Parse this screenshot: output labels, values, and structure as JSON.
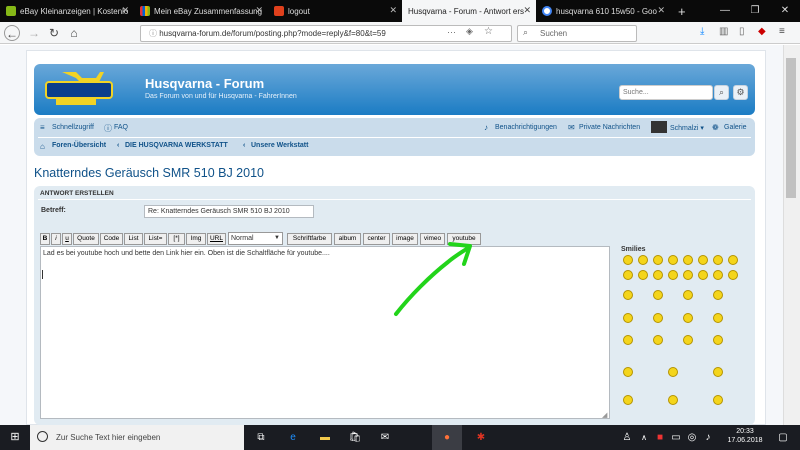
{
  "browser": {
    "tabs": [
      {
        "title": "eBay Kleinanzeigen | Kostenlo",
        "favicon_color": "#86b817",
        "active": false
      },
      {
        "title": "Mein eBay Zusammenfassung",
        "favicon_color": "#e53238",
        "active": false
      },
      {
        "title": "logout",
        "favicon_color": "#e0401c",
        "active": false
      },
      {
        "title": "Husqvarna - Forum - Antwort ers",
        "favicon_color": "#cccccc",
        "active": true
      },
      {
        "title": "husqvarna 610 15w50 - Goo",
        "favicon_color": "#4285f4",
        "active": false
      }
    ],
    "new_tab": "+",
    "url": "husqvarna-forum.de/forum/posting.php?mode=reply&f=80&t=59",
    "search_placeholder": "Suchen"
  },
  "forum": {
    "title": "Husqvarna - Forum",
    "description": "Das Forum von und für Husqvarna - FahrerInnen",
    "search_placeholder": "Suche...",
    "nav": {
      "quicklinks": "Schnellzugriff",
      "faq": "FAQ",
      "notifications": "Benachrichtigungen",
      "messages": "Private Nachrichten",
      "user": "Schmalzi",
      "gallery": "Galerie"
    },
    "breadcrumb": [
      "Foren-Übersicht",
      "DIE HUSQVARNA WERKSTATT",
      "Unsere Werkstatt"
    ],
    "breadcrumb_sep": "‹",
    "topic_title": "Knatterndes Geräusch SMR 510 BJ 2010"
  },
  "form": {
    "panel_title": "ANTWORT ERSTELLEN",
    "subject_label": "Betreff:",
    "subject_value": "Re: Knatterndes Geräusch SMR 510 BJ 2010",
    "toolbar": [
      "B",
      "i",
      "u",
      "Quote",
      "Code",
      "List",
      "List=",
      "[*]",
      "Img",
      "URL",
      "Schriftfarbe",
      "album",
      "center",
      "image",
      "vimeo",
      "youtube"
    ],
    "font_size": "Normal",
    "message": "Lad es bei youtube hoch und bette den Link hier ein. Oben  ist die Schaltfläche für youtube....",
    "smilies_title": "Smilies"
  },
  "taskbar": {
    "search_placeholder": "Zur Suche Text hier eingeben",
    "time": "20:33",
    "date": "17.06.2018"
  }
}
